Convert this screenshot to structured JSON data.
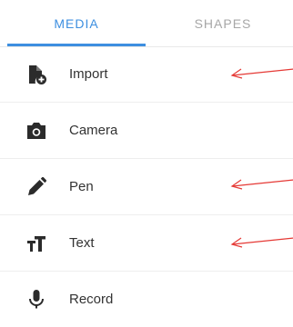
{
  "tabs": [
    {
      "label": "MEDIA",
      "active": true
    },
    {
      "label": "SHAPES",
      "active": false
    }
  ],
  "items": [
    {
      "label": "Import",
      "icon": "file-import-icon"
    },
    {
      "label": "Camera",
      "icon": "camera-icon"
    },
    {
      "label": "Pen",
      "icon": "pen-icon"
    },
    {
      "label": "Text",
      "icon": "text-size-icon"
    },
    {
      "label": "Record",
      "icon": "microphone-icon"
    }
  ],
  "colors": {
    "accent": "#3d8fe0",
    "inactive_tab": "#a7a7a7",
    "icon": "#2b2b2b",
    "annotation_arrow": "#e53935"
  }
}
